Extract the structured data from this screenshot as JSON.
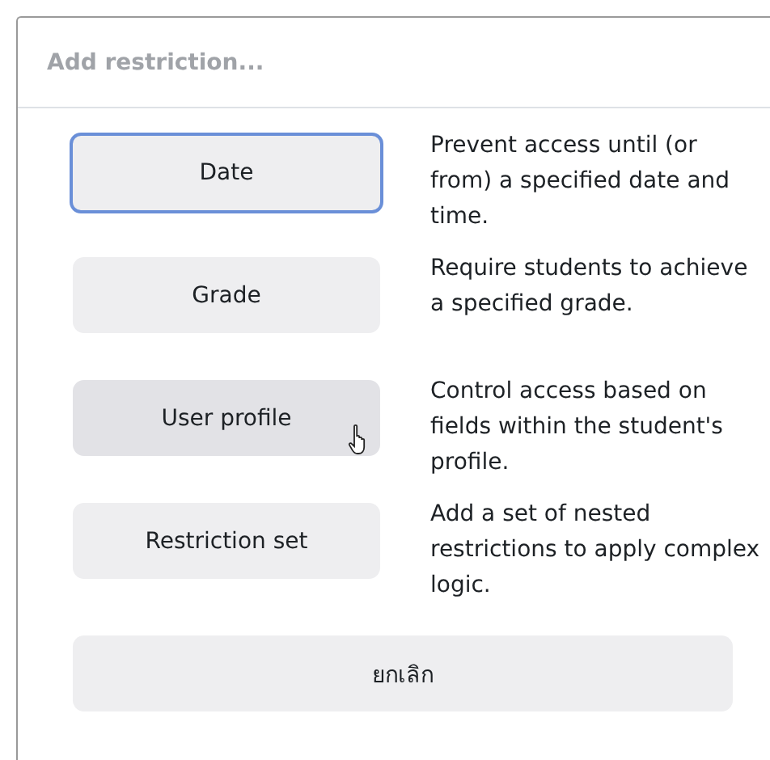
{
  "dialog": {
    "title": "Add restriction...",
    "options": [
      {
        "label": "Date",
        "description": "Prevent access until (or from) a specified date and time.",
        "focused": true,
        "hovered": false
      },
      {
        "label": "Grade",
        "description": "Require students to achieve a specified grade.",
        "focused": false,
        "hovered": false
      },
      {
        "label": "User profile",
        "description": "Control access based on fields within the student's profile.",
        "focused": false,
        "hovered": true
      },
      {
        "label": "Restriction set",
        "description": "Add a set of nested restrictions to apply complex logic.",
        "focused": false,
        "hovered": false
      }
    ],
    "cancel_button": "ยกเลิก"
  }
}
